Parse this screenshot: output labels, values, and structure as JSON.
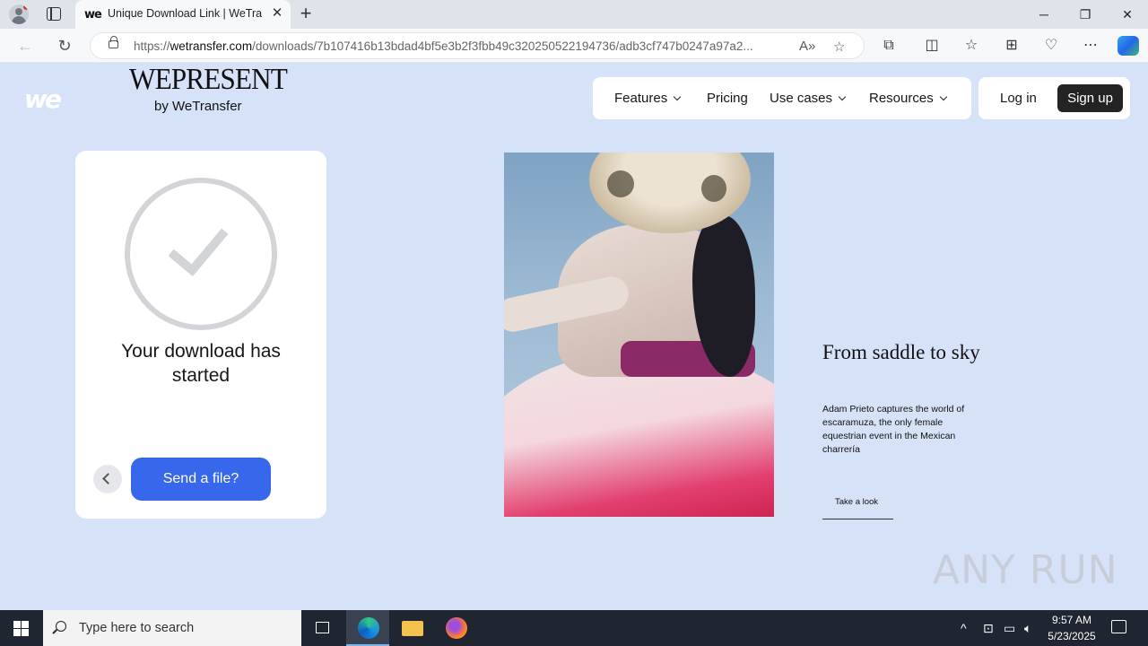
{
  "browser": {
    "tab_favicon": "we",
    "tab_title": "Unique Download Link | WeTransfer",
    "tab_close": "✕",
    "new_tab": "+",
    "url_prefix": "https://",
    "url_domain": "wetransfer.com",
    "url_path": "/downloads/7b107416b13bdad4bf5e3b2f3fbb49c320250522194736/adb3cf747b0247a97a2...",
    "icons": [
      "back-arrow-icon",
      "refresh-icon",
      "lock-icon",
      "read-aloud-icon",
      "favorite-star-icon",
      "extensions-icon",
      "split-screen-icon",
      "favorites-icon",
      "collections-icon",
      "browser-essentials-icon",
      "more-icon",
      "copilot-icon"
    ]
  },
  "header": {
    "logo": "we",
    "brand": "WEPRESENT",
    "brand_sub": "by WeTransfer",
    "nav": [
      {
        "label": "Features",
        "dropdown": true
      },
      {
        "label": "Pricing",
        "dropdown": false
      },
      {
        "label": "Use cases",
        "dropdown": true
      },
      {
        "label": "Resources",
        "dropdown": true
      }
    ],
    "login": "Log in",
    "signup": "Sign up"
  },
  "download_card": {
    "status": "Your download has started",
    "send_button": "Send a file?"
  },
  "article": {
    "title": "From saddle to sky",
    "description": "Adam Prieto captures the world of escaramuza, the only female equestrian event in the Mexican charrería",
    "link": "Take a look"
  },
  "watermark": "ANY RUN",
  "taskbar": {
    "search_placeholder": "Type here to search",
    "time": "9:57 AM",
    "date": "5/23/2025"
  },
  "colors": {
    "page_bg": "#d6e2f8",
    "primary_button": "#3767ea",
    "signup_bg": "#232323",
    "taskbar_bg": "#1f2531"
  }
}
